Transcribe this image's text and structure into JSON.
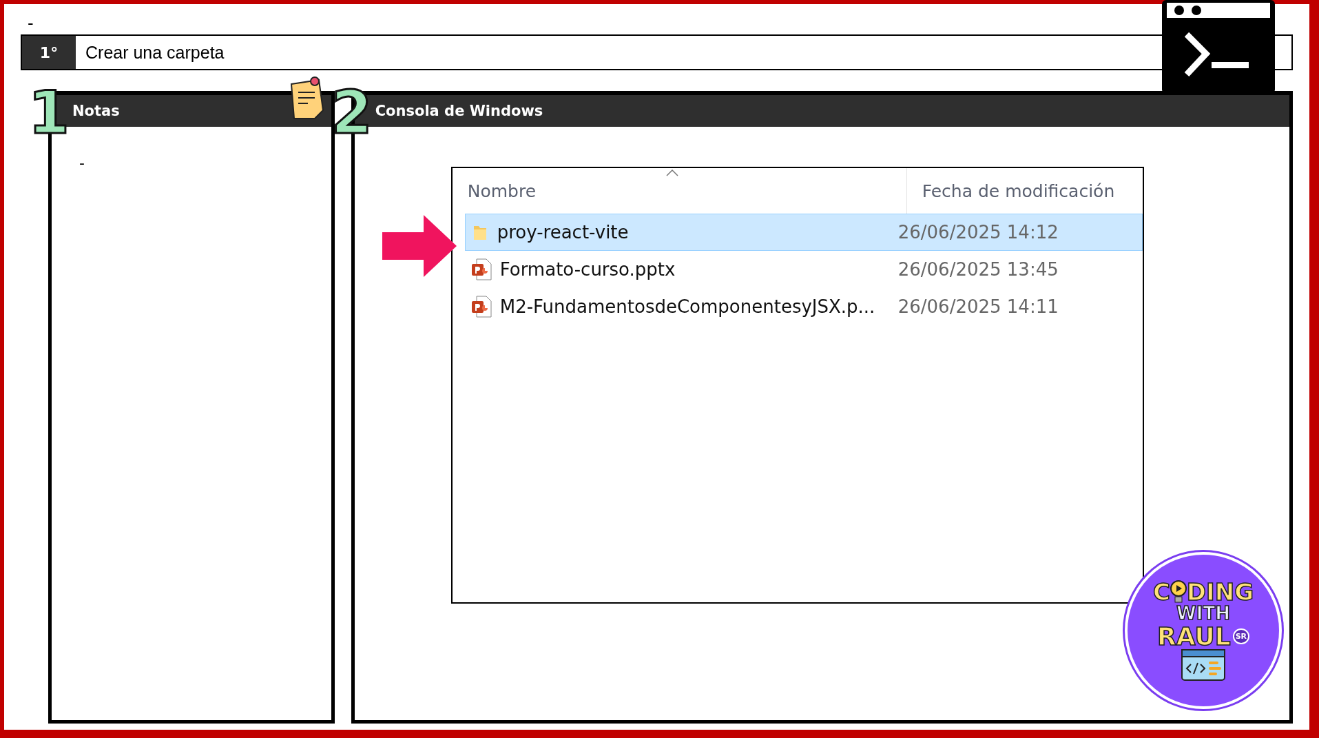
{
  "top_note": "-",
  "step": {
    "number": "1°",
    "title": "Crear una carpeta"
  },
  "notes_panel": {
    "number": "1",
    "title": "Notas",
    "body": "-"
  },
  "console_panel": {
    "number": "2",
    "title": "Consola de Windows",
    "explorer": {
      "columns": [
        {
          "label": "Nombre",
          "sorted": true
        },
        {
          "label": "Fecha de modificación",
          "sorted": false
        }
      ],
      "rows": [
        {
          "kind": "folder",
          "name": "proy-react-vite",
          "date": "26/06/2025 14:12",
          "selected": true
        },
        {
          "kind": "pptx",
          "name": "Formato-curso.pptx",
          "date": "26/06/2025 13:45",
          "selected": false
        },
        {
          "kind": "pptx",
          "name": "M2-FundamentosdeComponentesyJSX.p...",
          "date": "26/06/2025 14:11",
          "selected": false
        }
      ]
    }
  },
  "logo": {
    "first_letter": "C",
    "first_rest": "DING",
    "second": "WITH",
    "third": "RAUL",
    "badge": "SR"
  }
}
